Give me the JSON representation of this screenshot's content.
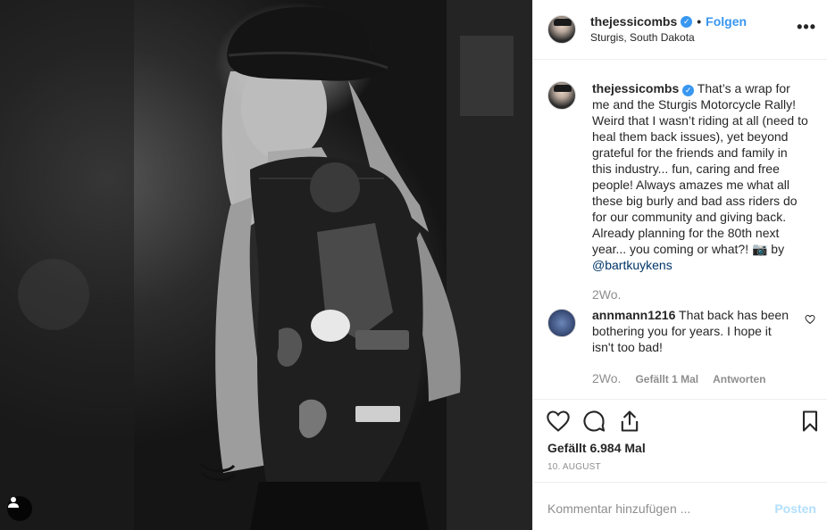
{
  "post": {
    "username": "thejessicombs",
    "follow_label": "Folgen",
    "location": "Sturgis, South Dakota",
    "more_label": "•••",
    "verified_mark": "✓"
  },
  "caption": {
    "username": "thejessicombs",
    "text": "That’s a wrap for me and the Sturgis Motorcycle Rally! Weird that I wasn’t riding at all (need to heal them back issues), yet beyond grateful for the friends and family in this industry... fun, caring and free people! Always amazes me what all these big burly and bad ass riders do for our community and giving back. Already planning for the 80th next year... you coming or what?! 📷 by",
    "mention": "@bartkuykens",
    "time": "2Wo."
  },
  "comment": {
    "username": "annmann1216",
    "text": "That back has been bothering you for years. I hope it isn't too bad!",
    "time": "2Wo.",
    "likes": "Gefällt 1 Mal",
    "reply": "Antworten"
  },
  "actions": {
    "like_icon": "heart-icon",
    "comment_icon": "comment-icon",
    "share_icon": "share-icon",
    "save_icon": "bookmark-icon",
    "likes_count": "Gefällt 6.984 Mal",
    "date": "10. AUGUST"
  },
  "add_comment": {
    "placeholder": "Kommentar hinzufügen ...",
    "post_label": "Posten"
  },
  "colors": {
    "link": "#3897f0",
    "muted": "#8e8e8e",
    "border": "#efefef"
  }
}
